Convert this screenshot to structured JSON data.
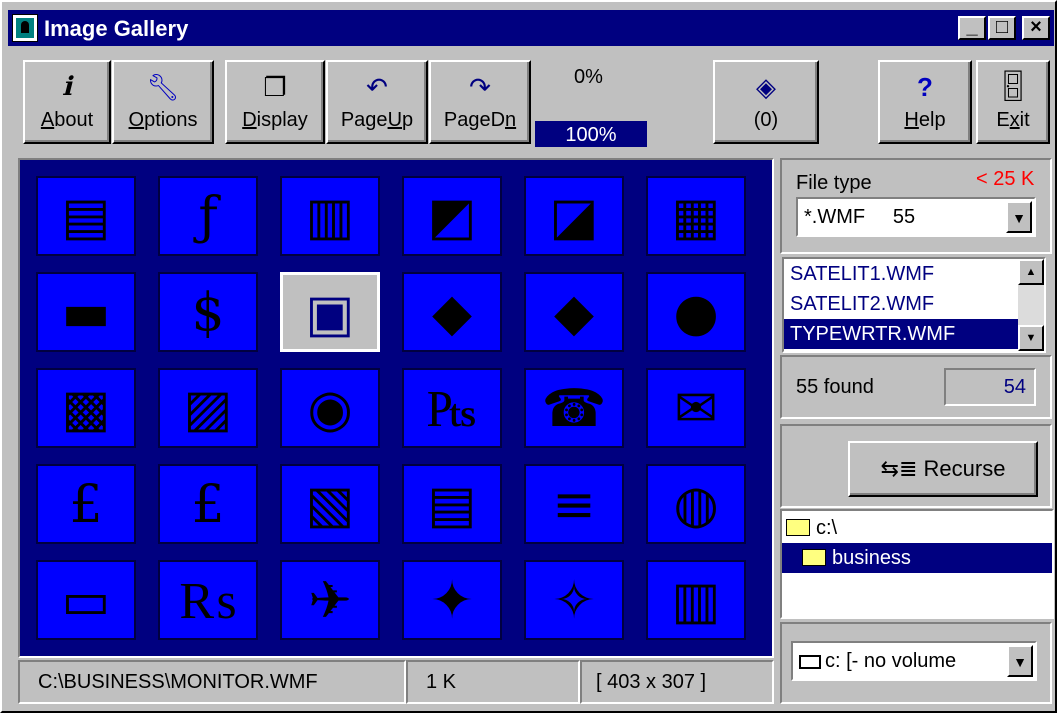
{
  "window": {
    "title": "Image Gallery"
  },
  "caption_buttons": {
    "minimize": "_",
    "maximize": "□",
    "close": "×"
  },
  "toolbar": {
    "about": {
      "label_u": "A",
      "label_rest": "bout",
      "icon": "info-icon"
    },
    "options": {
      "label_u": "O",
      "label_rest": "ptions",
      "icon": "wrench-icon"
    },
    "display": {
      "label_u": "D",
      "label_rest": "isplay",
      "icon": "pages-icon"
    },
    "pageup": {
      "label_pre": "Page",
      "label_u": "U",
      "label_rest": "p",
      "icon": "undo-arrow-icon"
    },
    "pagedn": {
      "label_pre": "PageD",
      "label_u": "n",
      "label_rest": "",
      "icon": "redo-arrow-icon"
    },
    "progress_top": "0%",
    "progress_bar": "100%",
    "progress_value": 1.0,
    "book": {
      "label": "(0)",
      "icon": "book-icon"
    },
    "help": {
      "label_u": "H",
      "label_rest": "elp",
      "icon": "help-icon"
    },
    "exit": {
      "label_pre": "E",
      "label_u": "x",
      "label_rest": "it",
      "icon": "exit-door-icon"
    }
  },
  "gallery": {
    "tiles": [
      {
        "name": "fax-machine-icon",
        "glyph": "▤"
      },
      {
        "name": "florin-icon",
        "glyph": "ƒ"
      },
      {
        "name": "server-icon",
        "glyph": "▥"
      },
      {
        "name": "laptop-icon",
        "glyph": "◩"
      },
      {
        "name": "notebook-computer-icon",
        "glyph": "◪"
      },
      {
        "name": "modem-rack-icon",
        "glyph": "▦"
      },
      {
        "name": "money-stack-icon",
        "glyph": "▬"
      },
      {
        "name": "money-bag-dollar-icon",
        "glyph": "$"
      },
      {
        "name": "monitor-icon",
        "glyph": "▣"
      },
      {
        "name": "device-box-icon",
        "glyph": "◆"
      },
      {
        "name": "device-box-2-icon",
        "glyph": "◆"
      },
      {
        "name": "disk-icon",
        "glyph": "●"
      },
      {
        "name": "workstation-icon",
        "glyph": "▩"
      },
      {
        "name": "desktop-computer-icon",
        "glyph": "▨"
      },
      {
        "name": "coin-icon",
        "glyph": "◉"
      },
      {
        "name": "pesetas-icon",
        "glyph": "₧"
      },
      {
        "name": "telephone-icon",
        "glyph": "☎"
      },
      {
        "name": "envelope-icon",
        "glyph": "✉"
      },
      {
        "name": "pound-sign-icon",
        "glyph": "£"
      },
      {
        "name": "money-bag-pound-icon",
        "glyph": "£"
      },
      {
        "name": "printer-icon",
        "glyph": "▧"
      },
      {
        "name": "keyboard-icon",
        "glyph": "▤"
      },
      {
        "name": "document-lines-icon",
        "glyph": "≡"
      },
      {
        "name": "globe-disk-icon",
        "glyph": "◍"
      },
      {
        "name": "scanner-icon",
        "glyph": "▭"
      },
      {
        "name": "rupee-icon",
        "glyph": "₨"
      },
      {
        "name": "satellite-dish-icon",
        "glyph": "✈"
      },
      {
        "name": "satellite-icon",
        "glyph": "✦"
      },
      {
        "name": "satellite-2-icon",
        "glyph": "✧"
      },
      {
        "name": "typewriter-icon",
        "glyph": "▥"
      }
    ],
    "selected_index": 8
  },
  "status": {
    "path": "C:\\BUSINESS\\MONITOR.WMF",
    "size": "1 K",
    "dims": "[ 403 x 307 ]"
  },
  "filter": {
    "label": "File type",
    "limit": "< 25 K",
    "limit_color": "#ff0000",
    "combo_value": "*.WMF     55"
  },
  "filelist": {
    "items": [
      "SATELIT1.WMF",
      "SATELIT2.WMF",
      "TYPEWRTR.WMF"
    ],
    "selected": 2
  },
  "found": {
    "label": "55 found",
    "value": "54"
  },
  "recurse": {
    "label": "Recurse",
    "icon": "recurse-icon"
  },
  "tree": {
    "nodes": [
      {
        "label": "c:\\",
        "selected": false
      },
      {
        "label": "business",
        "selected": true
      }
    ]
  },
  "drive": {
    "value": "c: [- no volume"
  },
  "colors": {
    "title_bar": "#000080",
    "gallery_bg": "#000080",
    "tile_bg": "#0000ff",
    "face": "#c0c0c0"
  }
}
